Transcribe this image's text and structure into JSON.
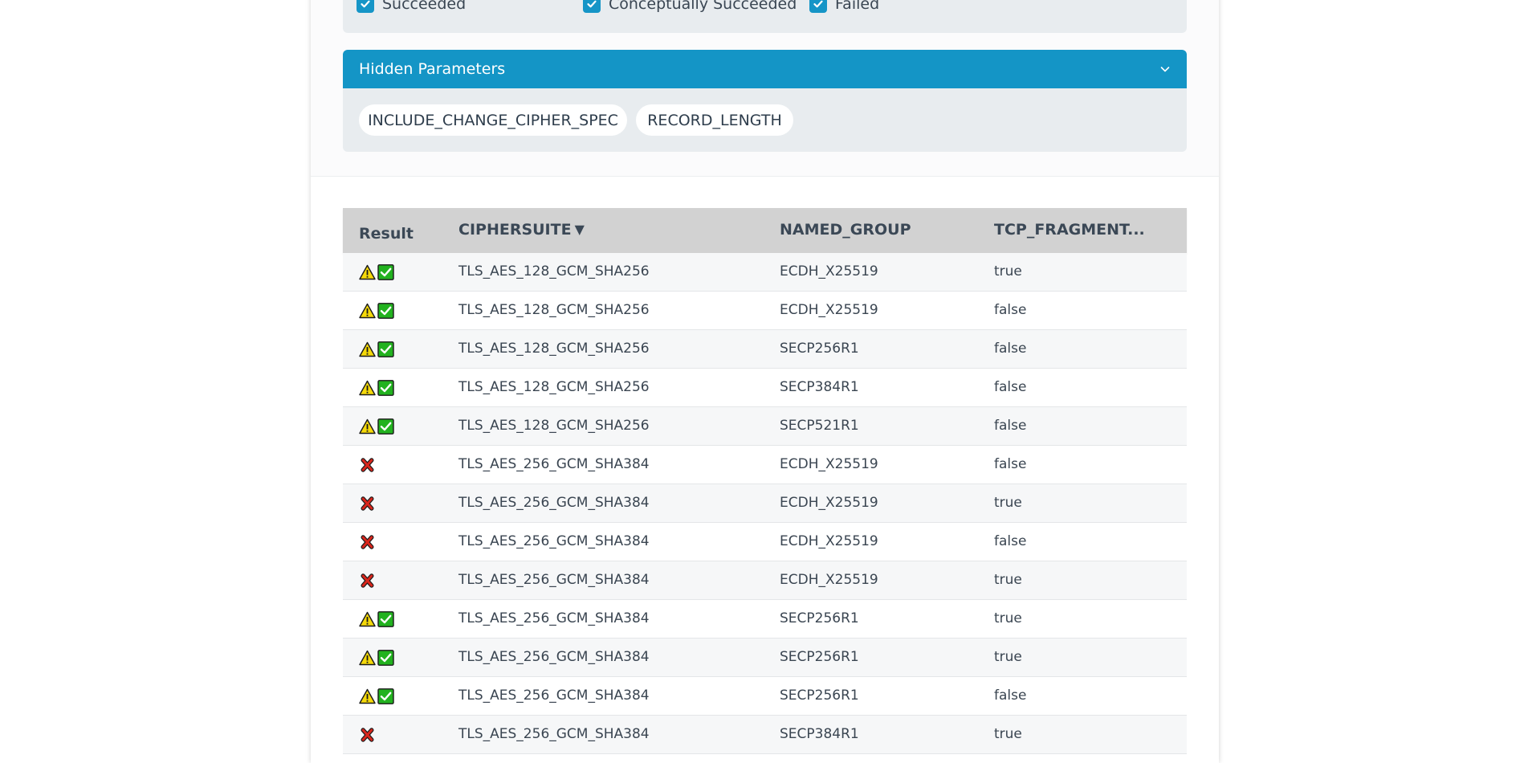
{
  "filters": {
    "items": [
      {
        "label": "Succeeded",
        "checked": true
      },
      {
        "label": "Conceptually Succeeded",
        "checked": true
      },
      {
        "label": "Failed",
        "checked": true
      }
    ]
  },
  "hidden_parameters": {
    "title": "Hidden Parameters",
    "chips": [
      "INCLUDE_CHANGE_CIPHER_SPEC",
      "RECORD_LENGTH"
    ]
  },
  "table": {
    "headers": [
      "Result",
      "CIPHERSUITE",
      "NAMED_GROUP",
      "TCP_FRAGMENT..."
    ],
    "sort_indicator": "▼",
    "rows": [
      {
        "result": "conceptually-succeeded",
        "ciphersuite": "TLS_AES_128_GCM_SHA256",
        "named_group": "ECDH_X25519",
        "tcp_fragment": "true"
      },
      {
        "result": "conceptually-succeeded",
        "ciphersuite": "TLS_AES_128_GCM_SHA256",
        "named_group": "ECDH_X25519",
        "tcp_fragment": "false"
      },
      {
        "result": "conceptually-succeeded",
        "ciphersuite": "TLS_AES_128_GCM_SHA256",
        "named_group": "SECP256R1",
        "tcp_fragment": "false"
      },
      {
        "result": "conceptually-succeeded",
        "ciphersuite": "TLS_AES_128_GCM_SHA256",
        "named_group": "SECP384R1",
        "tcp_fragment": "false"
      },
      {
        "result": "conceptually-succeeded",
        "ciphersuite": "TLS_AES_128_GCM_SHA256",
        "named_group": "SECP521R1",
        "tcp_fragment": "false"
      },
      {
        "result": "failed",
        "ciphersuite": "TLS_AES_256_GCM_SHA384",
        "named_group": "ECDH_X25519",
        "tcp_fragment": "false"
      },
      {
        "result": "failed",
        "ciphersuite": "TLS_AES_256_GCM_SHA384",
        "named_group": "ECDH_X25519",
        "tcp_fragment": "true"
      },
      {
        "result": "failed",
        "ciphersuite": "TLS_AES_256_GCM_SHA384",
        "named_group": "ECDH_X25519",
        "tcp_fragment": "false"
      },
      {
        "result": "failed",
        "ciphersuite": "TLS_AES_256_GCM_SHA384",
        "named_group": "ECDH_X25519",
        "tcp_fragment": "true"
      },
      {
        "result": "conceptually-succeeded",
        "ciphersuite": "TLS_AES_256_GCM_SHA384",
        "named_group": "SECP256R1",
        "tcp_fragment": "true"
      },
      {
        "result": "conceptually-succeeded",
        "ciphersuite": "TLS_AES_256_GCM_SHA384",
        "named_group": "SECP256R1",
        "tcp_fragment": "true"
      },
      {
        "result": "conceptually-succeeded",
        "ciphersuite": "TLS_AES_256_GCM_SHA384",
        "named_group": "SECP256R1",
        "tcp_fragment": "false"
      },
      {
        "result": "failed",
        "ciphersuite": "TLS_AES_256_GCM_SHA384",
        "named_group": "SECP384R1",
        "tcp_fragment": "true"
      }
    ]
  },
  "colors": {
    "accent": "#1495c6",
    "panel": "#e8ecef",
    "header_bg": "#d2d2d2",
    "warning": "#f5d90a",
    "success": "#22b21f",
    "fail": "#d9261c"
  },
  "icons": {
    "conceptually-succeeded": [
      "warning-icon",
      "check-mark-icon"
    ],
    "failed": [
      "cross-mark-icon"
    ]
  }
}
